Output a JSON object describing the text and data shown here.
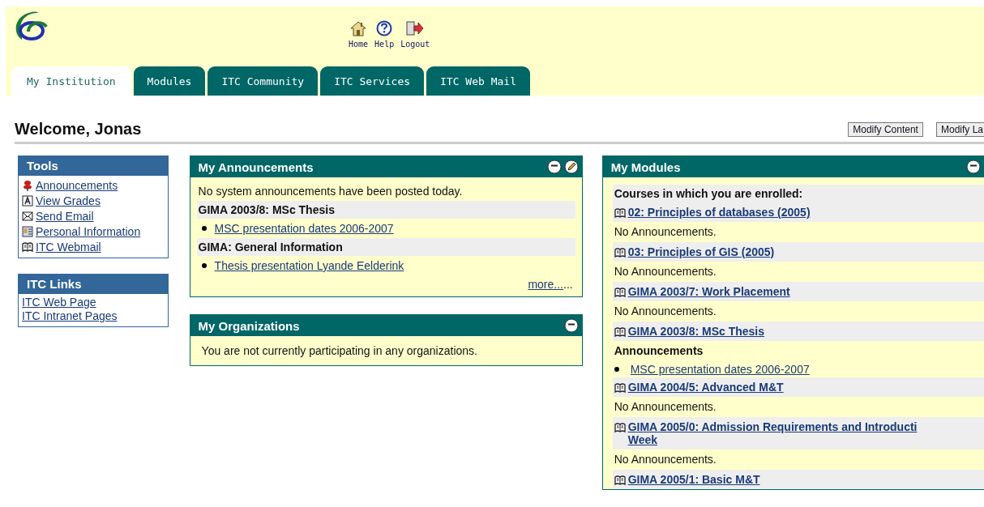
{
  "header": {
    "nav": [
      {
        "kind": "home",
        "label": "Home"
      },
      {
        "kind": "help",
        "label": "Help"
      },
      {
        "kind": "logout",
        "label": "Logout"
      }
    ]
  },
  "tabs": [
    {
      "label": "My Institution",
      "selected": true
    },
    {
      "label": "Modules",
      "selected": false
    },
    {
      "label": "ITC Community",
      "selected": false
    },
    {
      "label": "ITC Services",
      "selected": false
    },
    {
      "label": "ITC Web Mail",
      "selected": false
    }
  ],
  "welcome": "Welcome, Jonas",
  "page_buttons": [
    "Modify Content",
    "Modify La"
  ],
  "tools": {
    "title": "Tools",
    "items": [
      {
        "kind": "pin",
        "label": "Announcements"
      },
      {
        "kind": "grades",
        "label": "View Grades"
      },
      {
        "kind": "mail",
        "label": "Send Email"
      },
      {
        "kind": "card",
        "label": "Personal Information"
      },
      {
        "kind": "book",
        "label": "ITC Webmail"
      }
    ]
  },
  "itc_links": {
    "title": "ITC Links",
    "items": [
      "ITC Web Page",
      "ITC Intranet Pages"
    ]
  },
  "announcements": {
    "title": "My Announcements",
    "intro": "No system announcements have been posted today.",
    "groups": [
      {
        "title": "GIMA 2003/8: MSc Thesis",
        "items": [
          "MSC presentation dates 2006-2007"
        ]
      },
      {
        "title": "GIMA: General Information",
        "items": [
          "Thesis presentation Lyande Eelderink"
        ]
      }
    ],
    "more_link": "more...",
    "more_trail": "..."
  },
  "organizations": {
    "title": "My Organizations",
    "text": "You are not currently participating in any organizations."
  },
  "modules": {
    "title": "My Modules",
    "heading": "Courses in which you are enrolled:",
    "courses": [
      {
        "title": [
          "02: Principles of databases (2005)"
        ],
        "note": "No Announcements."
      },
      {
        "title": [
          "03: Principles of GIS (2005)"
        ],
        "note": "No Announcements."
      },
      {
        "title": [
          "GIMA 2003/7: Work Placement"
        ],
        "note": "No Announcements."
      },
      {
        "title": [
          "GIMA 2003/8: MSc Thesis"
        ],
        "announcements_title": "Announcements",
        "items": [
          "MSC presentation dates 2006-2007"
        ]
      },
      {
        "title": [
          "GIMA 2004/5: Advanced M&T"
        ],
        "note": "No Announcements."
      },
      {
        "title": [
          "GIMA 2005/0: Admission Requirements and Introducti",
          "Week"
        ],
        "note": "No Announcements."
      },
      {
        "title": [
          "GIMA 2005/1: Basic M&T"
        ]
      }
    ]
  }
}
